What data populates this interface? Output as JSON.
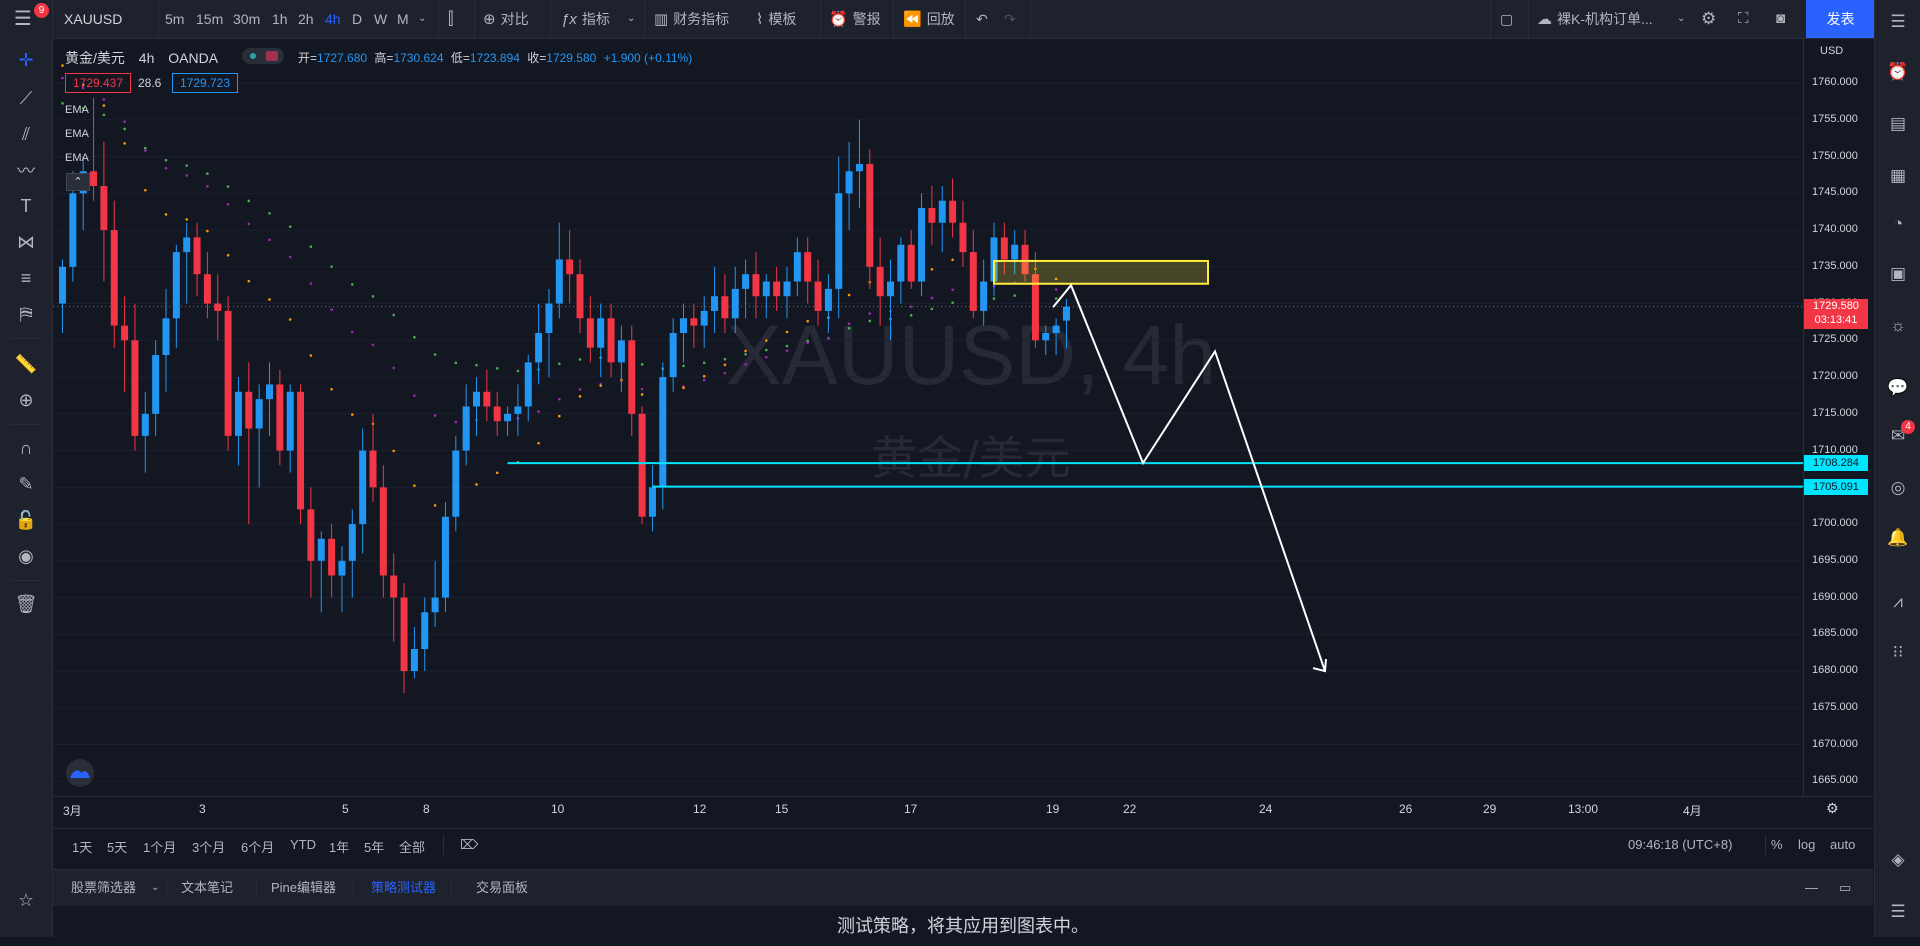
{
  "topbar": {
    "notif_count": "9",
    "symbol": "XAUUSD",
    "intervals": [
      "5m",
      "15m",
      "30m",
      "1h",
      "2h",
      "4h",
      "D",
      "W",
      "M"
    ],
    "active_interval": "4h",
    "compare": "对比",
    "indicators": "指标",
    "financials": "财务指标",
    "templates": "模板",
    "alert": "警报",
    "replay": "回放",
    "layout_name": "裸K-机构订单...",
    "publish": "发表"
  },
  "legend": {
    "title": "黄金/美元",
    "interval": "4h",
    "exchange": "OANDA",
    "open_label": "开=",
    "open": "1727.680",
    "high_label": "高=",
    "high": "1730.624",
    "low_label": "低=",
    "low": "1723.894",
    "close_label": "收=",
    "close": "1729.580",
    "change": "+1.900 (+0.11%)",
    "bid": "1729.437",
    "spread": "28.6",
    "ask": "1729.723",
    "indicators": [
      "EMA",
      "EMA",
      "EMA"
    ]
  },
  "watermark": {
    "symbol": "XAUUSD, 4h",
    "name": "黄金/美元"
  },
  "colors": {
    "bg": "#131722",
    "up": "#2196f3",
    "down": "#f23645",
    "ema_green": "#4caf50",
    "ema_purple": "#9c27b0",
    "ema_orange": "#ff9800",
    "level": "#00e5ff",
    "zone": "#ffeb3b",
    "accent": "#2962ff"
  },
  "price_axis": {
    "currency": "USD",
    "labels": [
      "1760.000",
      "1755.000",
      "1750.000",
      "1745.000",
      "1740.000",
      "1735.000",
      "1730.000",
      "1725.000",
      "1720.000",
      "1715.000",
      "1710.000",
      "1705.000",
      "1700.000",
      "1695.000",
      "1690.000",
      "1685.000",
      "1680.000",
      "1675.000",
      "1670.000",
      "1665.000"
    ],
    "last_price": "1729.580",
    "countdown": "03:13:41",
    "level1": "1708.284",
    "level2": "1705.091"
  },
  "chart_data": {
    "type": "candlestick",
    "ylim": [
      1663,
      1766
    ],
    "last_price": 1729.58,
    "x_labels": [
      "3月",
      "3",
      "5",
      "8",
      "10",
      "12",
      "15",
      "17",
      "19",
      "22",
      "24",
      "26",
      "29",
      "13:00",
      "4月"
    ],
    "horizontal_levels": [
      1708.284,
      1705.091
    ],
    "candles": [
      {
        "o": 1730,
        "h": 1736,
        "l": 1726,
        "c": 1735
      },
      {
        "o": 1735,
        "h": 1748,
        "l": 1733,
        "c": 1745
      },
      {
        "o": 1745,
        "h": 1750,
        "l": 1740,
        "c": 1748
      },
      {
        "o": 1748,
        "h": 1758,
        "l": 1744,
        "c": 1746
      },
      {
        "o": 1746,
        "h": 1752,
        "l": 1733,
        "c": 1740
      },
      {
        "o": 1740,
        "h": 1744,
        "l": 1724,
        "c": 1727
      },
      {
        "o": 1727,
        "h": 1731,
        "l": 1718,
        "c": 1725
      },
      {
        "o": 1725,
        "h": 1730,
        "l": 1710,
        "c": 1712
      },
      {
        "o": 1712,
        "h": 1718,
        "l": 1707,
        "c": 1715
      },
      {
        "o": 1715,
        "h": 1725,
        "l": 1712,
        "c": 1723
      },
      {
        "o": 1723,
        "h": 1732,
        "l": 1718,
        "c": 1728
      },
      {
        "o": 1728,
        "h": 1738,
        "l": 1724,
        "c": 1737
      },
      {
        "o": 1737,
        "h": 1741,
        "l": 1730,
        "c": 1739
      },
      {
        "o": 1739,
        "h": 1741,
        "l": 1731,
        "c": 1734
      },
      {
        "o": 1734,
        "h": 1737,
        "l": 1728,
        "c": 1730
      },
      {
        "o": 1730,
        "h": 1734,
        "l": 1725,
        "c": 1729
      },
      {
        "o": 1729,
        "h": 1731,
        "l": 1710,
        "c": 1712
      },
      {
        "o": 1712,
        "h": 1720,
        "l": 1708,
        "c": 1718
      },
      {
        "o": 1718,
        "h": 1722,
        "l": 1700,
        "c": 1713
      },
      {
        "o": 1713,
        "h": 1719,
        "l": 1705,
        "c": 1717
      },
      {
        "o": 1717,
        "h": 1722,
        "l": 1712,
        "c": 1719
      },
      {
        "o": 1719,
        "h": 1721,
        "l": 1708,
        "c": 1710
      },
      {
        "o": 1710,
        "h": 1719,
        "l": 1707,
        "c": 1718
      },
      {
        "o": 1718,
        "h": 1719,
        "l": 1700,
        "c": 1702
      },
      {
        "o": 1702,
        "h": 1705,
        "l": 1690,
        "c": 1695
      },
      {
        "o": 1695,
        "h": 1699,
        "l": 1688,
        "c": 1698
      },
      {
        "o": 1698,
        "h": 1700,
        "l": 1690,
        "c": 1693
      },
      {
        "o": 1693,
        "h": 1697,
        "l": 1688,
        "c": 1695
      },
      {
        "o": 1695,
        "h": 1702,
        "l": 1690,
        "c": 1700
      },
      {
        "o": 1700,
        "h": 1713,
        "l": 1696,
        "c": 1710
      },
      {
        "o": 1710,
        "h": 1715,
        "l": 1703,
        "c": 1705
      },
      {
        "o": 1705,
        "h": 1708,
        "l": 1690,
        "c": 1693
      },
      {
        "o": 1693,
        "h": 1696,
        "l": 1684,
        "c": 1690
      },
      {
        "o": 1690,
        "h": 1692,
        "l": 1677,
        "c": 1680
      },
      {
        "o": 1680,
        "h": 1686,
        "l": 1679,
        "c": 1683
      },
      {
        "o": 1683,
        "h": 1690,
        "l": 1680,
        "c": 1688
      },
      {
        "o": 1688,
        "h": 1695,
        "l": 1686,
        "c": 1690
      },
      {
        "o": 1690,
        "h": 1703,
        "l": 1688,
        "c": 1701
      },
      {
        "o": 1701,
        "h": 1712,
        "l": 1699,
        "c": 1710
      },
      {
        "o": 1710,
        "h": 1719,
        "l": 1708,
        "c": 1716
      },
      {
        "o": 1716,
        "h": 1720,
        "l": 1712,
        "c": 1718
      },
      {
        "o": 1718,
        "h": 1721,
        "l": 1714,
        "c": 1716
      },
      {
        "o": 1716,
        "h": 1718,
        "l": 1712,
        "c": 1714
      },
      {
        "o": 1714,
        "h": 1716,
        "l": 1712,
        "c": 1715
      },
      {
        "o": 1715,
        "h": 1719,
        "l": 1712,
        "c": 1716
      },
      {
        "o": 1716,
        "h": 1723,
        "l": 1714,
        "c": 1722
      },
      {
        "o": 1722,
        "h": 1730,
        "l": 1719,
        "c": 1726
      },
      {
        "o": 1726,
        "h": 1732,
        "l": 1720,
        "c": 1730
      },
      {
        "o": 1730,
        "h": 1741,
        "l": 1728,
        "c": 1736
      },
      {
        "o": 1736,
        "h": 1740,
        "l": 1730,
        "c": 1734
      },
      {
        "o": 1734,
        "h": 1736,
        "l": 1726,
        "c": 1728
      },
      {
        "o": 1728,
        "h": 1731,
        "l": 1722,
        "c": 1724
      },
      {
        "o": 1724,
        "h": 1730,
        "l": 1720,
        "c": 1728
      },
      {
        "o": 1728,
        "h": 1730,
        "l": 1720,
        "c": 1722
      },
      {
        "o": 1722,
        "h": 1727,
        "l": 1718,
        "c": 1725
      },
      {
        "o": 1725,
        "h": 1727,
        "l": 1712,
        "c": 1715
      },
      {
        "o": 1715,
        "h": 1716,
        "l": 1700,
        "c": 1701
      },
      {
        "o": 1701,
        "h": 1708,
        "l": 1699,
        "c": 1705
      },
      {
        "o": 1705,
        "h": 1722,
        "l": 1702,
        "c": 1720
      },
      {
        "o": 1720,
        "h": 1728,
        "l": 1718,
        "c": 1726
      },
      {
        "o": 1726,
        "h": 1730,
        "l": 1722,
        "c": 1728
      },
      {
        "o": 1728,
        "h": 1730,
        "l": 1724,
        "c": 1727
      },
      {
        "o": 1727,
        "h": 1731,
        "l": 1724,
        "c": 1729
      },
      {
        "o": 1729,
        "h": 1735,
        "l": 1726,
        "c": 1731
      },
      {
        "o": 1731,
        "h": 1734,
        "l": 1726,
        "c": 1728
      },
      {
        "o": 1728,
        "h": 1735,
        "l": 1726,
        "c": 1732
      },
      {
        "o": 1732,
        "h": 1736,
        "l": 1728,
        "c": 1734
      },
      {
        "o": 1734,
        "h": 1737,
        "l": 1728,
        "c": 1731
      },
      {
        "o": 1731,
        "h": 1734,
        "l": 1728,
        "c": 1733
      },
      {
        "o": 1733,
        "h": 1735,
        "l": 1729,
        "c": 1731
      },
      {
        "o": 1731,
        "h": 1735,
        "l": 1728,
        "c": 1733
      },
      {
        "o": 1733,
        "h": 1739,
        "l": 1731,
        "c": 1737
      },
      {
        "o": 1737,
        "h": 1739,
        "l": 1730,
        "c": 1733
      },
      {
        "o": 1733,
        "h": 1736,
        "l": 1727,
        "c": 1729
      },
      {
        "o": 1729,
        "h": 1734,
        "l": 1726,
        "c": 1732
      },
      {
        "o": 1732,
        "h": 1750,
        "l": 1728,
        "c": 1745
      },
      {
        "o": 1745,
        "h": 1752,
        "l": 1740,
        "c": 1748
      },
      {
        "o": 1748,
        "h": 1755,
        "l": 1743,
        "c": 1749
      },
      {
        "o": 1749,
        "h": 1751,
        "l": 1732,
        "c": 1735
      },
      {
        "o": 1735,
        "h": 1739,
        "l": 1727,
        "c": 1731
      },
      {
        "o": 1731,
        "h": 1736,
        "l": 1725,
        "c": 1733
      },
      {
        "o": 1733,
        "h": 1739,
        "l": 1730,
        "c": 1738
      },
      {
        "o": 1738,
        "h": 1740,
        "l": 1732,
        "c": 1733
      },
      {
        "o": 1733,
        "h": 1745,
        "l": 1731,
        "c": 1743
      },
      {
        "o": 1743,
        "h": 1746,
        "l": 1738,
        "c": 1741
      },
      {
        "o": 1741,
        "h": 1746,
        "l": 1737,
        "c": 1744
      },
      {
        "o": 1744,
        "h": 1747,
        "l": 1739,
        "c": 1741
      },
      {
        "o": 1741,
        "h": 1744,
        "l": 1735,
        "c": 1737
      },
      {
        "o": 1737,
        "h": 1740,
        "l": 1728,
        "c": 1729
      },
      {
        "o": 1729,
        "h": 1736,
        "l": 1727,
        "c": 1733
      },
      {
        "o": 1733,
        "h": 1741,
        "l": 1731,
        "c": 1739
      },
      {
        "o": 1739,
        "h": 1741,
        "l": 1734,
        "c": 1736
      },
      {
        "o": 1736,
        "h": 1740,
        "l": 1734,
        "c": 1738
      },
      {
        "o": 1738,
        "h": 1740,
        "l": 1733,
        "c": 1734
      },
      {
        "o": 1734,
        "h": 1737,
        "l": 1724,
        "c": 1725
      },
      {
        "o": 1725,
        "h": 1727,
        "l": 1723,
        "c": 1726
      },
      {
        "o": 1726,
        "h": 1728,
        "l": 1723,
        "c": 1727
      },
      {
        "o": 1727.68,
        "h": 1730.624,
        "l": 1723.894,
        "c": 1729.58
      }
    ]
  },
  "time_axis": [
    "3月",
    "3",
    "5",
    "8",
    "10",
    "12",
    "15",
    "17",
    "19",
    "22",
    "24",
    "26",
    "29",
    "13:00",
    "4月"
  ],
  "range_bar": {
    "ranges": [
      "1天",
      "5天",
      "1个月",
      "3个月",
      "6个月",
      "YTD",
      "1年",
      "5年",
      "全部"
    ],
    "clock": "09:46:18 (UTC+8)",
    "percent": "%",
    "log": "log",
    "auto": "auto"
  },
  "bottom_tabs": {
    "tabs": [
      "股票筛选器",
      "文本笔记",
      "Pine编辑器",
      "策略测试器",
      "交易面板"
    ],
    "active": "策略测试器",
    "message": "测试策略，将其应用到图表中。"
  },
  "right_toolbar": {
    "chat_badge": "4"
  }
}
